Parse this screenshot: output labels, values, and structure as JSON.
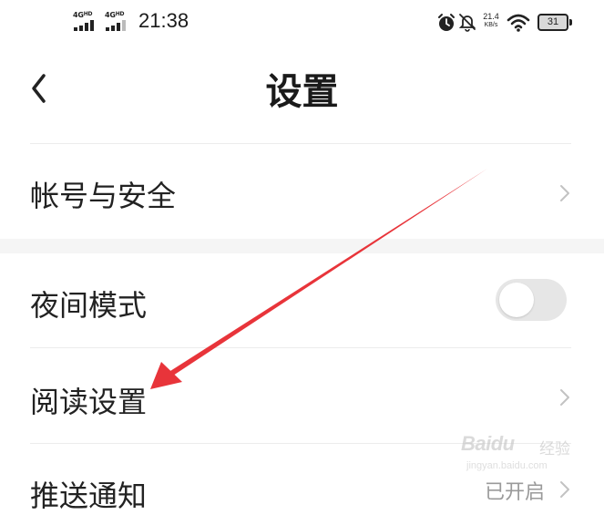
{
  "status_bar": {
    "network_left": "4G",
    "network_left_sup": "HD",
    "network_right": "4G",
    "network_right_sup": "HD",
    "time": "21:38",
    "net_speed_value": "21.4",
    "net_speed_unit": "KB/s",
    "battery": "31",
    "icons": [
      "alarm-icon",
      "bell-muted-icon",
      "wifi-icon",
      "battery-icon"
    ]
  },
  "header": {
    "title": "设置",
    "back_icon": "chevron-left-icon"
  },
  "settings": {
    "account": {
      "label": "帐号与安全",
      "icon": "chevron-right-icon"
    },
    "night_mode": {
      "label": "夜间模式",
      "toggle_on": false
    },
    "reading": {
      "label": "阅读设置",
      "icon": "chevron-right-icon"
    },
    "push": {
      "label": "推送通知",
      "value": "已开启",
      "icon": "chevron-right-icon"
    }
  },
  "colors": {
    "annotation_arrow": "#e8343a",
    "toggle_off_track": "#e6e6e6",
    "section_gap": "#f5f5f5"
  },
  "watermark": {
    "brand": "Baidu",
    "text": "经验",
    "domain": "jingyan.baidu.com"
  }
}
